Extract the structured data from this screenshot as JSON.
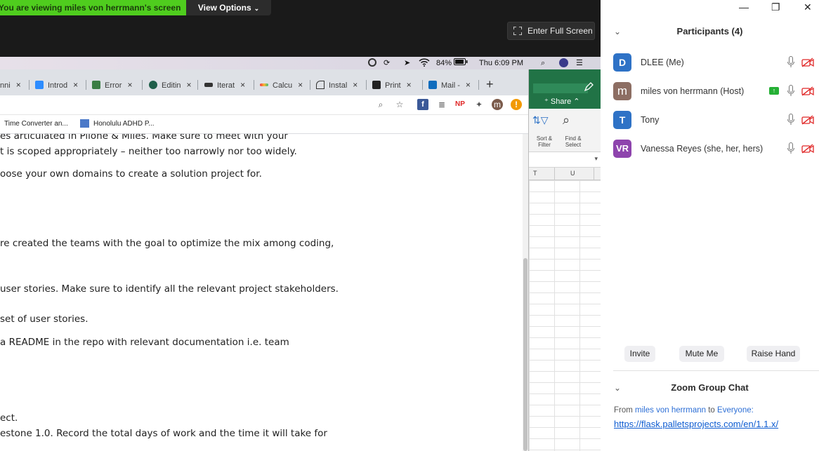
{
  "share": {
    "viewing_text": "You are viewing miles von herrmann's screen",
    "view_options": "View Options",
    "view_options_caret": "⌄",
    "fullscreen_label": "Enter Full Screen"
  },
  "mac_menubar": {
    "battery": "84%",
    "clock": "Thu 6:09 PM"
  },
  "browser": {
    "tabs": [
      {
        "label": "nni"
      },
      {
        "label": "Introd"
      },
      {
        "label": "Error"
      },
      {
        "label": "Editin"
      },
      {
        "label": "Iterat"
      },
      {
        "label": "Calcu"
      },
      {
        "label": "Instal"
      },
      {
        "label": "Print"
      },
      {
        "label": "Mail -"
      }
    ],
    "tab_close": "×",
    "newtab": "+",
    "profile_initial": "m",
    "bookmarks": [
      {
        "label": "Time Converter an..."
      },
      {
        "label": "Honolulu ADHD P..."
      }
    ],
    "doc_lines": [
      "es articulated in Pilone & Miles. Make sure to meet with your",
      "t is scoped appropriately – neither too narrowly nor too widely.",
      "oose your own domains to create a solution project for.",
      "re created the teams with the goal to optimize the mix among coding,",
      "user stories. Make sure to identify all the relevant project stakeholders.",
      "set of user stories.",
      "a README in the repo with relevant documentation i.e. team",
      "ect.",
      "estone 1.0. Record the total days of work and the time it will take for"
    ]
  },
  "excel": {
    "share_label": "Share",
    "sort_filter": "Sort &\nFilter",
    "find_select": "Find &\nSelect",
    "col_t": "T",
    "col_u": "U"
  },
  "panel": {
    "title": "Participants (4)",
    "participants": [
      {
        "initial": "D",
        "name": "DLEE (Me)",
        "color": "#2e72c6"
      },
      {
        "initial": "m",
        "name": "miles von herrmann (Host)",
        "color": "#8d6e63"
      },
      {
        "initial": "T",
        "name": "Tony",
        "color": "#2e72c6"
      },
      {
        "initial": "VR",
        "name": "Vanessa Reyes (she, her, hers)",
        "color": "#8e44ad"
      }
    ],
    "buttons": {
      "invite": "Invite",
      "mute": "Mute Me",
      "raise": "Raise Hand"
    },
    "chat_title": "Zoom Group Chat",
    "chat": {
      "from_prefix": "From",
      "sender": "miles von herrmann",
      "to_word": "to",
      "recipient": "Everyone:",
      "link": "https://flask.palletsprojects.com/en/1.1.x/"
    }
  },
  "colors": {
    "viewing_bar": "#4fcd1e",
    "excel_green": "#217346",
    "muted_red": "#e02828",
    "link_blue": "#0e5cd1"
  }
}
